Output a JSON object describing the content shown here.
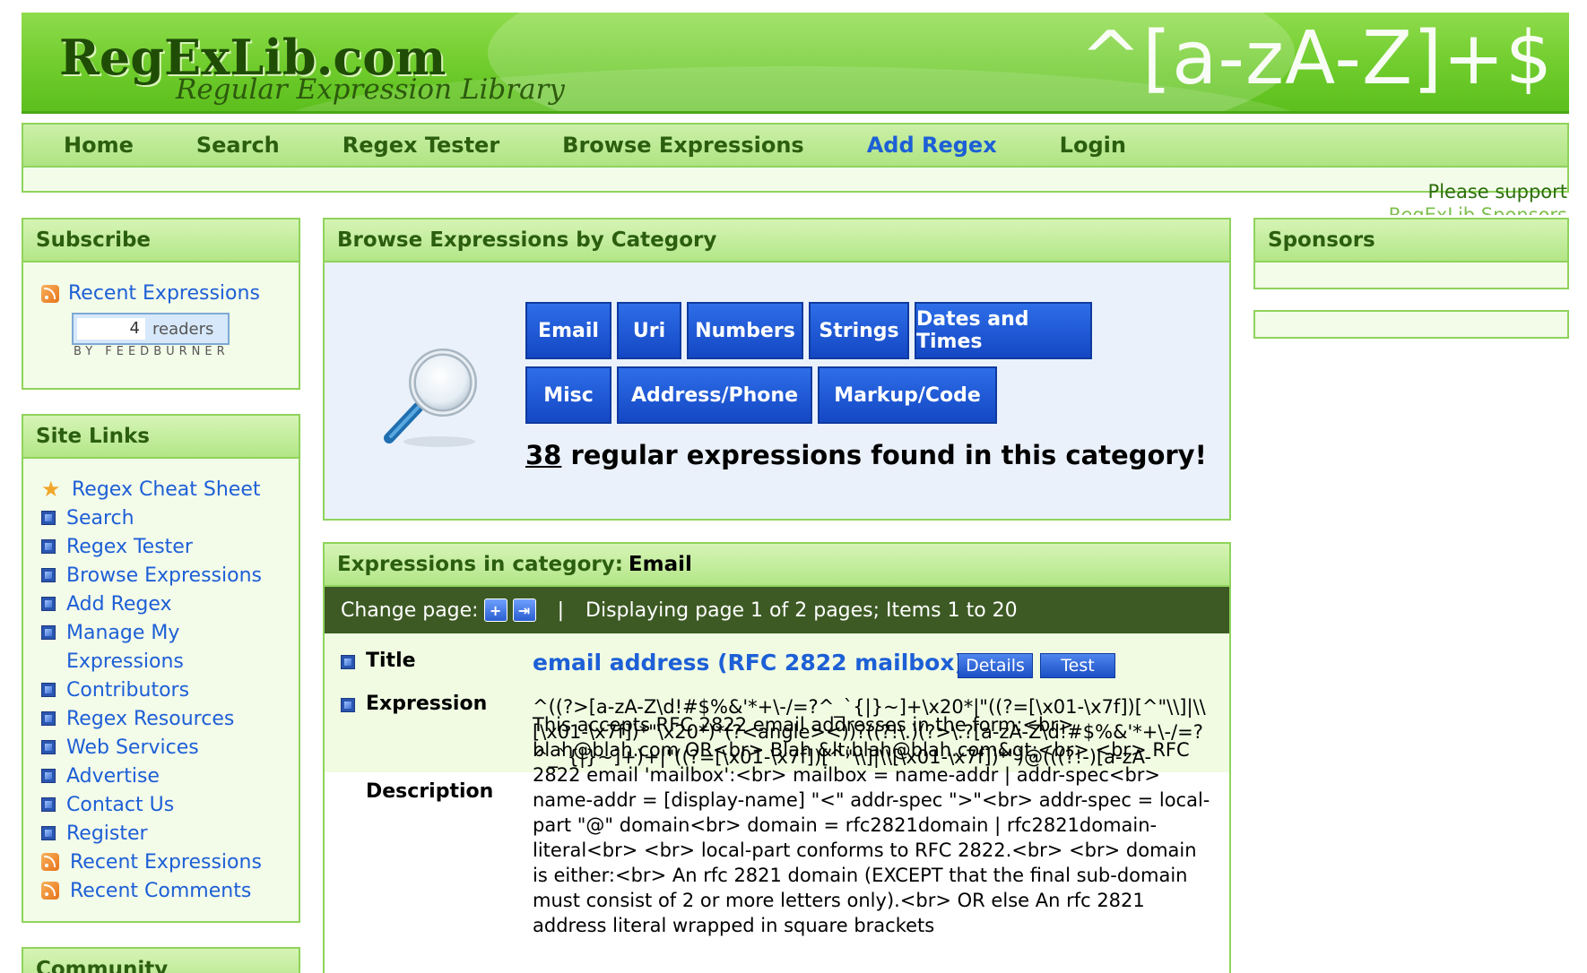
{
  "header": {
    "logo_main": "RegExLib.com",
    "logo_sub": "Regular Expression Library",
    "banner_regex": "^[a-zA-Z]+$"
  },
  "nav": {
    "items": [
      {
        "label": "Home"
      },
      {
        "label": "Search"
      },
      {
        "label": "Regex Tester"
      },
      {
        "label": "Browse Expressions"
      },
      {
        "label": "Add Regex"
      },
      {
        "label": "Login"
      }
    ],
    "support_line1": "Please support",
    "support_line2": "RegExLib Sponsors"
  },
  "subscribe": {
    "title": "Subscribe",
    "link": "Recent Expressions",
    "feed_count": "4",
    "feed_readers": "readers",
    "feed_by": "BY FEEDBURNER"
  },
  "sitelinks": {
    "title": "Site Links",
    "items": [
      {
        "label": "Regex Cheat Sheet",
        "icon": "star-icon"
      },
      {
        "label": "Search",
        "icon": "bullet-icon"
      },
      {
        "label": "Regex Tester",
        "icon": "bullet-icon"
      },
      {
        "label": "Browse Expressions",
        "icon": "bullet-icon"
      },
      {
        "label": "Add Regex",
        "icon": "bullet-icon"
      },
      {
        "label": "Manage My",
        "icon": "bullet-icon"
      },
      {
        "label": "Expressions",
        "icon": "none"
      },
      {
        "label": "Contributors",
        "icon": "bullet-icon"
      },
      {
        "label": "Regex Resources",
        "icon": "bullet-icon"
      },
      {
        "label": "Web Services",
        "icon": "bullet-icon"
      },
      {
        "label": "Advertise",
        "icon": "bullet-icon"
      },
      {
        "label": "Contact Us",
        "icon": "bullet-icon"
      },
      {
        "label": "Register",
        "icon": "bullet-icon"
      },
      {
        "label": "Recent Expressions",
        "icon": "rss-icon"
      },
      {
        "label": "Recent Comments",
        "icon": "rss-icon"
      }
    ]
  },
  "community": {
    "title": "Community"
  },
  "browse": {
    "title": "Browse Expressions by Category",
    "categories": [
      "Email",
      "Uri",
      "Numbers",
      "Strings",
      "Dates and Times",
      "Misc",
      "Address/Phone",
      "Markup/Code"
    ],
    "count": "38",
    "count_text": " regular expressions found in this category!"
  },
  "expressions": {
    "title_prefix": "Expressions in category:",
    "category": "Email",
    "pager_label": "Change page:",
    "pager_sep": "|",
    "pager_info": "Displaying page 1 of 2 pages; Items 1 to 20",
    "item": {
      "title_label": "Title",
      "title": "email address (RFC 2822 mailbox)",
      "details_button": "Details",
      "test_button": "Test",
      "expression_label": "Expression",
      "expression": "^((?>[a-zA-Z\\d!#$%&'*+\\-/=?^_`{|}~]+\\x20*|\"((?=[\\x01-\\x7f])[^\"\\\\]|\\\\[\\x01-\\x7f])*\"\\x20*)*(?<angle><))?((?!\\.)(?>\\.?[a-zA-Z\\d!#$%&'*+\\-/=?^_`{|}~]+)+|\"((?=[\\x01-\\x7f])[^\"\\\\]|\\\\[\\x01-\\x7f])*\")@(((?!-)[a-zA-",
      "description_label": "Description",
      "description": "This accepts RFC 2822 email addresses in the form:<br> blah@blah.com OR<br> Blah &lt;blah@blah.com&gt;<br> <br> RFC 2822 email 'mailbox':<br> mailbox = name-addr | addr-spec<br> name-addr = [display-name] \"<\" addr-spec \">\"<br> addr-spec = local-part \"@\" domain<br> domain = rfc2821domain | rfc2821domain-literal<br> <br> local-part conforms to RFC 2822.<br> <br> domain is either:<br> An rfc 2821 domain (EXCEPT that the final sub-domain must consist of 2 or more letters only).<br> OR else An rfc 2821 address literal wrapped in square brackets"
    }
  },
  "sponsors": {
    "title": "Sponsors"
  },
  "colors": {
    "green_header": "#6fcc2c",
    "nav_text": "#2b5e0f",
    "link_blue": "#1d5fd6",
    "category_button": "#1447c4",
    "pager_bg": "#3d5a24"
  }
}
